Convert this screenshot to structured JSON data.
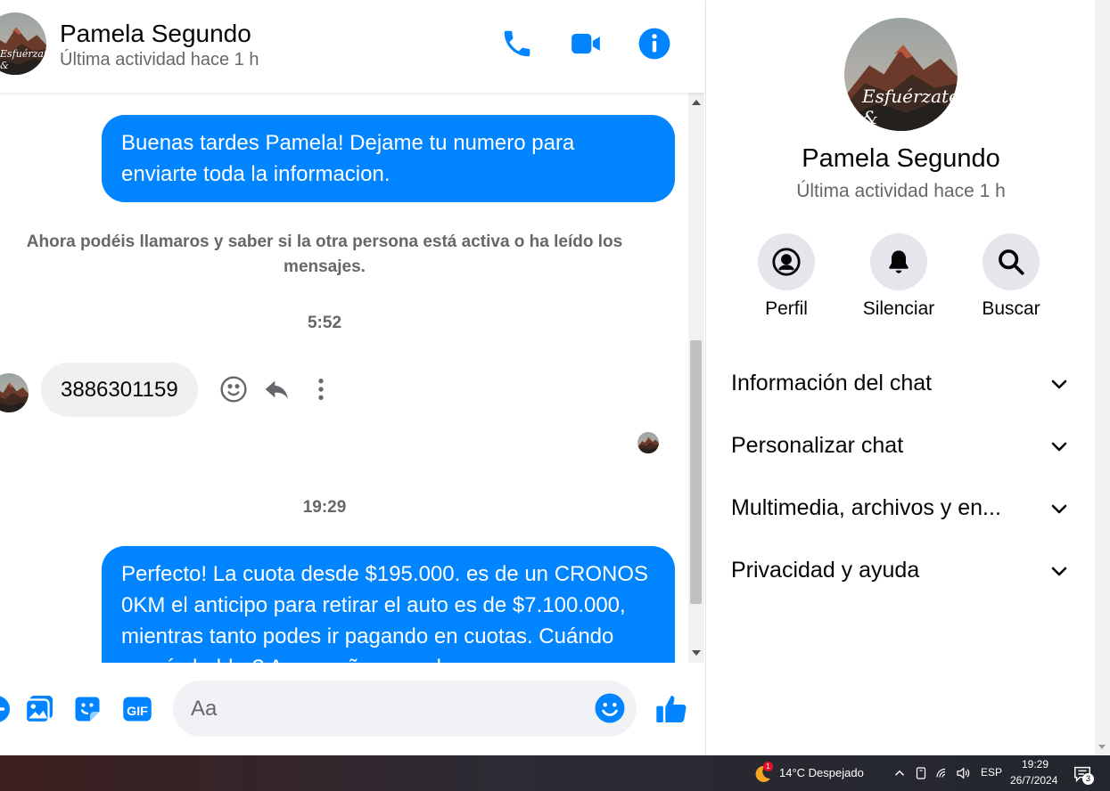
{
  "contact": {
    "name": "Pamela Segundo",
    "status": "Última actividad hace 1 h",
    "avatar_text": "Esfuérzate &"
  },
  "header": {
    "call_icon": "phone-icon",
    "video_icon": "video-camera-icon",
    "info_icon": "info-icon"
  },
  "messages": {
    "out_1": "Buenas tardes Pamela! Dejame tu numero para enviarte toda la informacion.",
    "system_note": "Ahora podéis llamaros y saber si la otra persona está activa o ha leído los mensajes.",
    "time_1": "5:52",
    "in_1": "3886301159",
    "time_2": "19:29",
    "out_2": "Perfecto! La cuota desde $195.000. es de un CRONOS 0KM el anticipo para retirar el auto es de $7.100.000, mientras tanto podes ir pagando en cuotas. Cuándo querés hablar? Acompañame en la"
  },
  "composer": {
    "placeholder": "Aa"
  },
  "info_panel": {
    "actions": [
      {
        "label": "Perfil",
        "icon": "profile-icon"
      },
      {
        "label": "Silenciar",
        "icon": "bell-icon"
      },
      {
        "label": "Buscar",
        "icon": "search-icon"
      }
    ],
    "sections": [
      {
        "label": "Información del chat"
      },
      {
        "label": "Personalizar chat"
      },
      {
        "label": "Multimedia, archivos y en..."
      },
      {
        "label": "Privacidad y ayuda"
      }
    ]
  },
  "taskbar": {
    "weather_badge": "1",
    "weather": "14°C  Despejado",
    "language": "ESP",
    "time": "19:29",
    "date": "26/7/2024",
    "notifications": "3"
  },
  "colors": {
    "accent": "#0084ff",
    "bubble_in": "#f0f0f0",
    "secondary_text": "#65676b"
  }
}
